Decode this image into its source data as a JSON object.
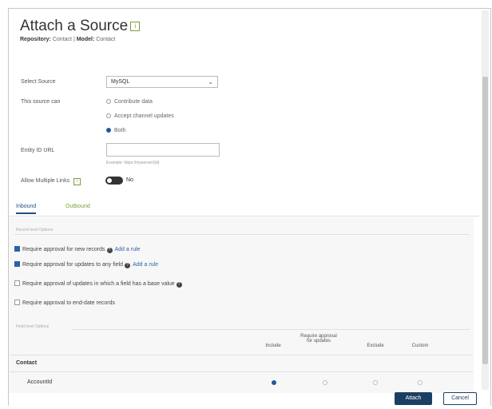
{
  "header": {
    "title": "Attach a Source",
    "repository_label": "Repository:",
    "repository_value": "Contact",
    "model_label": "Model:",
    "model_value": "Contact",
    "separator": "|"
  },
  "form": {
    "select_source_label": "Select Source",
    "select_source_value": "MySQL",
    "source_can_label": "This source can",
    "source_can_options": [
      {
        "label": "Contribute data",
        "selected": false
      },
      {
        "label": "Accept channel updates",
        "selected": false
      },
      {
        "label": "Both",
        "selected": true
      }
    ],
    "entity_url_label": "Entity ID URL",
    "entity_url_value": "",
    "entity_url_hint": "Example: https://myserver/{id}",
    "allow_multiple_label": "Allow Multiple Links",
    "allow_multiple_state": "No"
  },
  "tabs": [
    {
      "label": "Inbound",
      "active": true
    },
    {
      "label": "Outbound",
      "active": false
    }
  ],
  "record_options": {
    "section_label": "Record level Options",
    "items": [
      {
        "label": "Require approval for new records",
        "checked": true,
        "link": "Add a rule"
      },
      {
        "label": "Require approval for updates to any field",
        "checked": true,
        "link": "Add a rule"
      },
      {
        "label": "Require approval of updates in which a field has a base value",
        "checked": false,
        "link": ""
      },
      {
        "label": "Require approval to end-date records",
        "checked": false,
        "link": ""
      }
    ]
  },
  "field_options": {
    "section_label": "Field level Options",
    "columns": [
      "Include",
      "Require approval for updates",
      "Exclude",
      "Custom"
    ],
    "group": "Contact",
    "rows": [
      {
        "label": "AccountId",
        "selected_column": 0
      }
    ]
  },
  "footer": {
    "attach_label": "Attach",
    "cancel_label": "Cancel"
  },
  "colors": {
    "primary": "#1b3f63",
    "accent_green": "#7b9e3b",
    "link_blue": "#2a63a8"
  }
}
